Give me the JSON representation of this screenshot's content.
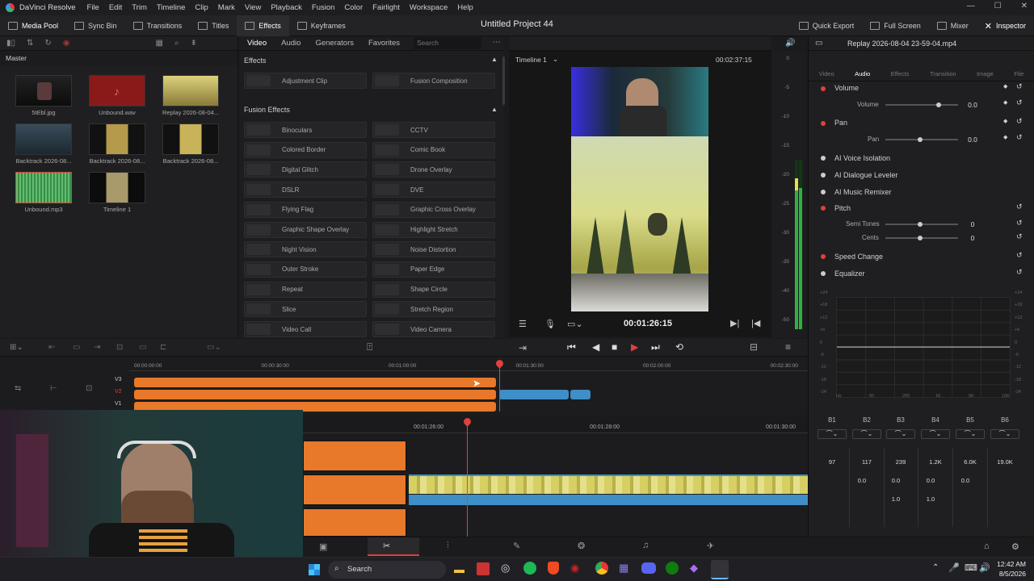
{
  "menubar": {
    "app": "DaVinci Resolve",
    "items": [
      "File",
      "Edit",
      "Trim",
      "Timeline",
      "Clip",
      "Mark",
      "View",
      "Playback",
      "Fusion",
      "Color",
      "Fairlight",
      "Workspace",
      "Help"
    ]
  },
  "toolbar": {
    "media_pool": "Media Pool",
    "sync_bin": "Sync Bin",
    "transitions": "Transitions",
    "titles": "Titles",
    "effects": "Effects",
    "keyframes": "Keyframes",
    "project_title": "Untitled Project 44",
    "quick_export": "Quick Export",
    "full_screen": "Full Screen",
    "mixer": "Mixer",
    "inspector": "Inspector"
  },
  "media_pool": {
    "bin": "Master",
    "clips": [
      {
        "name": "5tEbl.jpg"
      },
      {
        "name": "Unbound.wav"
      },
      {
        "name": "Replay 2026-08-04..."
      },
      {
        "name": "Backtrack 2026-08..."
      },
      {
        "name": "Backtrack 2026-08..."
      },
      {
        "name": "Backtrack 2026-08..."
      },
      {
        "name": "Unbound.mp3"
      },
      {
        "name": "Timeline 1"
      }
    ]
  },
  "effects": {
    "tabs": [
      "Video",
      "Audio",
      "Generators",
      "Favorites"
    ],
    "search_placeholder": "Search",
    "section_effects": "Effects",
    "section_fusion": "Fusion Effects",
    "top_items": [
      "Adjustment Clip",
      "Fusion Composition"
    ],
    "fusion_items": [
      "Binoculars",
      "CCTV",
      "Colored Border",
      "Comic Book",
      "Digital Glitch",
      "Drone Overlay",
      "DSLR",
      "DVE",
      "Flying Flag",
      "Graphic Cross Overlay",
      "Graphic Shape Overlay",
      "Highlight Stretch",
      "Night Vision",
      "Noise Distortion",
      "Outer Stroke",
      "Paper Edge",
      "Repeat",
      "Shape Circle",
      "Slice",
      "Stretch Region",
      "Video Call",
      "Video Camera"
    ]
  },
  "viewer": {
    "timeline_name": "Timeline 1",
    "duration": "00:02:37:15",
    "timecode": "00:01:26:15"
  },
  "meter_scale": [
    "0",
    "-5",
    "-10",
    "-15",
    "-20",
    "-25",
    "-30",
    "-35",
    "-40",
    "-50"
  ],
  "inspector": {
    "clip_title": "Replay 2026-08-04 23-59-04.mp4",
    "tabs": [
      "Video",
      "Audio",
      "Effects",
      "Transition",
      "Image",
      "File"
    ],
    "volume": {
      "title": "Volume",
      "label": "Volume",
      "value": "0.0"
    },
    "pan": {
      "title": "Pan",
      "label": "Pan",
      "value": "0.0"
    },
    "ai": [
      "AI Voice Isolation",
      "AI Dialogue Leveler",
      "AI Music Remixer"
    ],
    "pitch": {
      "title": "Pitch",
      "semi_label": "Semi Tones",
      "semi": "0",
      "cents_label": "Cents",
      "cents": "0"
    },
    "speed": "Speed Change",
    "equalizer": "Equalizer",
    "eq_y": [
      "+24",
      "+18",
      "+12",
      "+6",
      "0",
      "-6",
      "-12",
      "-18",
      "-24"
    ],
    "eq_x": [
      "Hz",
      "50",
      "200",
      "1K",
      "5K",
      "10K"
    ],
    "bands": [
      "B1",
      "B2",
      "B3",
      "B4",
      "B5",
      "B6"
    ],
    "freqs": [
      "97",
      "117",
      "239",
      "1.2K",
      "6.0K",
      "19.0K"
    ],
    "gains": [
      "0.0",
      "0.0",
      "0.0",
      "0.0"
    ],
    "qs": [
      "1.0",
      "1.0"
    ]
  },
  "timeline": {
    "ruler_upper": [
      "00:00:00:00",
      "00:00:30:00",
      "00:01:00:00",
      "00:01:30:00",
      "00:02:00:00",
      "00:02:30:00"
    ],
    "tracks": [
      "V3",
      "V2",
      "V1"
    ],
    "ruler_lower": [
      "00:01:26:00",
      "00:01:28:00",
      "00:01:30:00"
    ]
  },
  "taskbar": {
    "search": "Search",
    "time": "12:42 AM",
    "date": "8/5/2026"
  },
  "colors": {
    "accent_red": "#e04040",
    "clip_orange": "#e8782a",
    "clip_blue": "#3e8fc7",
    "clip_yellow": "#d6cf63"
  }
}
